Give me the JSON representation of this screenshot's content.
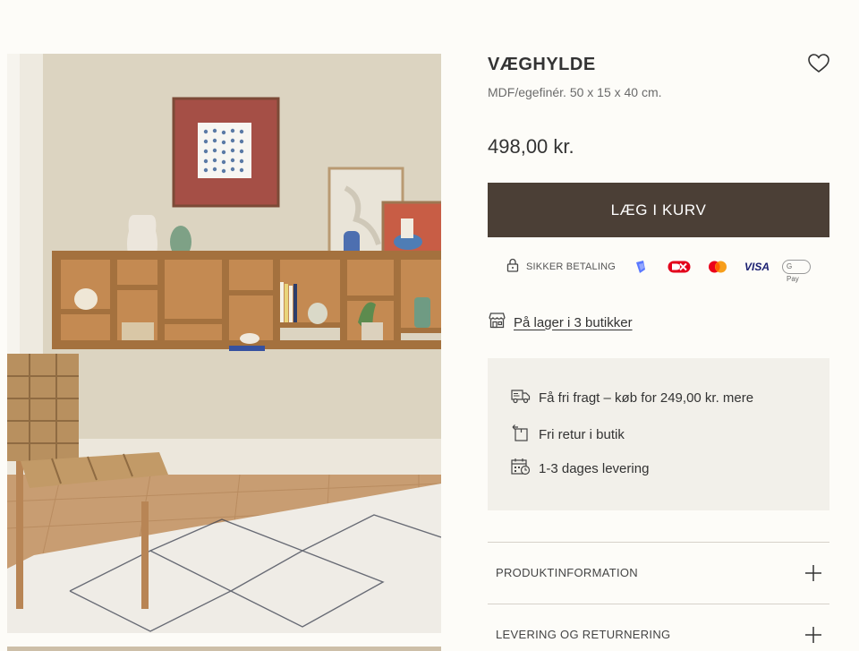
{
  "product": {
    "title": "VÆGHYLDE",
    "subtitle": "MDF/egefinér. 50 x 15 x 40 cm.",
    "price": "498,00 kr.",
    "add_to_cart_label": "LÆG I KURV"
  },
  "payment": {
    "secure_label": "SIKKER BETALING",
    "methods": [
      "mobilepay-icon",
      "dankort-icon",
      "mastercard-icon",
      "visa-icon",
      "google-pay-icon"
    ],
    "visa_text": "VISA",
    "gpay_text": "G Pay"
  },
  "stock": {
    "label": "På lager i 3 butikker"
  },
  "benefits": [
    {
      "icon": "truck-icon",
      "text": "Få fri fragt – køb for 249,00 kr. mere"
    },
    {
      "icon": "return-box-icon",
      "text": "Fri retur i butik"
    },
    {
      "icon": "calendar-clock-icon",
      "text": "1-3 dages levering"
    }
  ],
  "accordions": [
    {
      "label": "PRODUKTINFORMATION"
    },
    {
      "label": "LEVERING OG RETURNERING"
    }
  ],
  "colors": {
    "button_bg": "#4b3f36",
    "info_bg": "#f2f0ea",
    "page_bg": "#fdfcf8"
  }
}
